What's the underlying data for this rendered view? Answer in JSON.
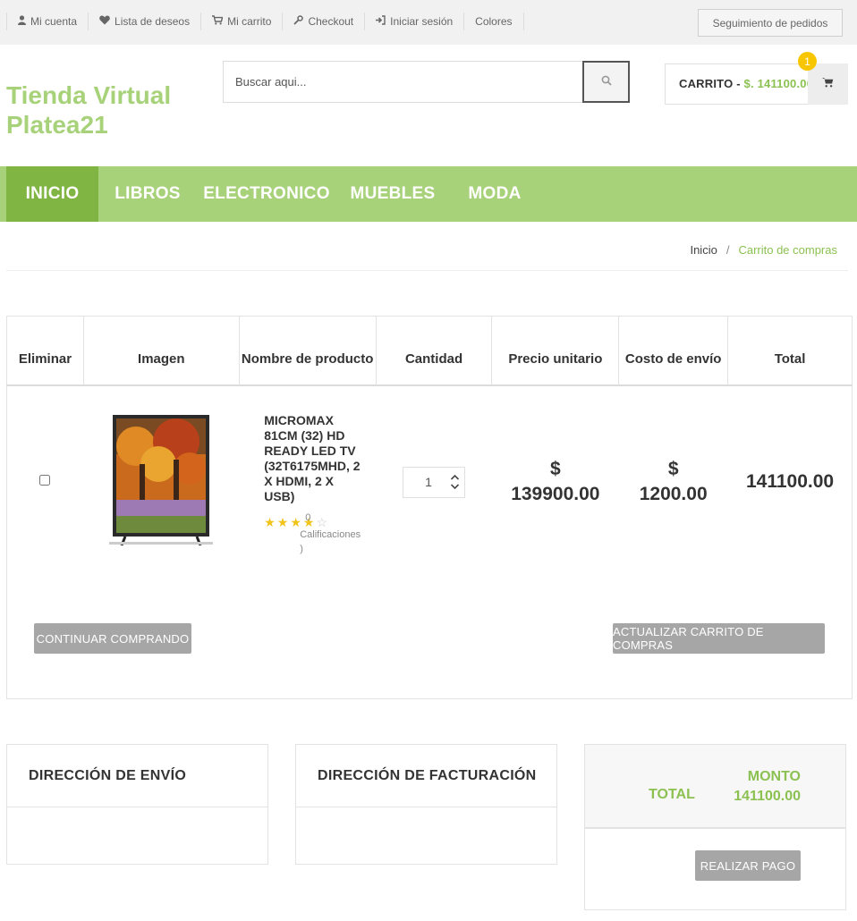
{
  "topbar": {
    "links": [
      {
        "icon": "user-icon",
        "glyph": "☺",
        "label": "Mi cuenta"
      },
      {
        "icon": "heart-icon",
        "glyph": "♥",
        "label": "Lista de deseos"
      },
      {
        "icon": "cart-icon",
        "glyph": "☰",
        "label": "Mi carrito"
      },
      {
        "icon": "wrench-icon",
        "glyph": "⚒",
        "label": "Checkout"
      },
      {
        "icon": "sign-in-icon",
        "glyph": "➜",
        "label": "Iniciar sesión"
      },
      {
        "icon": "",
        "glyph": "",
        "label": "Colores"
      }
    ],
    "track_orders": "Seguimiento de pedidos"
  },
  "header": {
    "logo": "Tienda Virtual Platea21",
    "search_placeholder": "Buscar aqui...",
    "cart_label": "CARRITO -",
    "cart_amount": "$. 141100.00",
    "cart_count": "1"
  },
  "nav": {
    "items": [
      "INICIO",
      "LIBROS",
      "ELECTRONICO",
      "MUEBLES",
      "MODA"
    ],
    "active": "INICIO"
  },
  "breadcrumb": {
    "home": "Inicio",
    "separator": "/",
    "current": "Carrito de compras"
  },
  "cart_table": {
    "headers": [
      "Eliminar",
      "Imagen",
      "Nombre de producto",
      "Cantidad",
      "Precio unitario",
      "Costo de envío",
      "Total"
    ],
    "rows": [
      {
        "name": "MICROMAX 81CM (32) HD READY LED TV (32T6175MHD, 2 X HDMI, 2 X USB)",
        "rating_filled": 4,
        "rating_max": 5,
        "rating_count": "0",
        "ratings_label": "Calificaciones",
        "ratings_close": ")",
        "quantity": "1",
        "unit_price_symbol": "$",
        "unit_price": "139900.00",
        "shipping_symbol": "$",
        "shipping": "1200.00",
        "total": "141100.00"
      }
    ],
    "continue_button": "CONTINUAR COMPRANDO",
    "update_button": "ACTUALIZAR CARRITO DE COMPRAS"
  },
  "shipping_panel": {
    "title": "DIRECCIÓN DE ENVÍO"
  },
  "billing_panel": {
    "title": "DIRECCIÓN DE FACTURACIÓN"
  },
  "summary": {
    "total_label": "TOTAL",
    "monto_label": "MONTO",
    "monto_value": "141100.00",
    "pay_button": "REALIZAR PAGO"
  },
  "colors": {
    "accent_green": "#a8d27a",
    "active_green": "#80b543",
    "text_green": "#8cc152",
    "badge_yellow": "#f7c600",
    "button_grey": "#a6a6a6"
  }
}
